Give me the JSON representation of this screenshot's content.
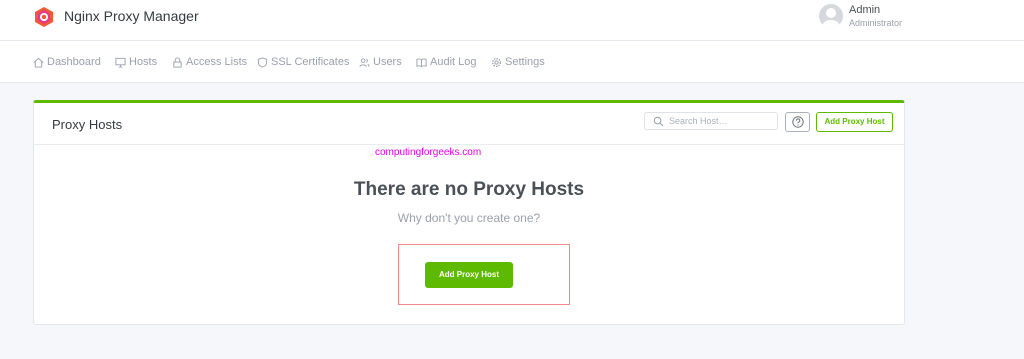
{
  "header": {
    "app_title": "Nginx Proxy Manager",
    "user_name": "Admin",
    "user_role": "Administrator"
  },
  "nav": {
    "items": [
      {
        "label": "Dashboard",
        "icon": "home-icon"
      },
      {
        "label": "Hosts",
        "icon": "monitor-icon"
      },
      {
        "label": "Access Lists",
        "icon": "lock-icon"
      },
      {
        "label": "SSL Certificates",
        "icon": "shield-icon"
      },
      {
        "label": "Users",
        "icon": "users-icon"
      },
      {
        "label": "Audit Log",
        "icon": "book-icon"
      },
      {
        "label": "Settings",
        "icon": "gear-icon"
      }
    ]
  },
  "card": {
    "title": "Proxy Hosts",
    "search_placeholder": "Search Host…",
    "add_button_label": "Add Proxy Host",
    "watermark": "computingforgeeks.com",
    "empty_title": "There are no Proxy Hosts",
    "empty_subtitle": "Why don't you create one?",
    "empty_add_button_label": "Add Proxy Host"
  },
  "colors": {
    "accent": "#5eba00",
    "watermark": "#e300e3",
    "highlight_border": "#f08a8a"
  }
}
